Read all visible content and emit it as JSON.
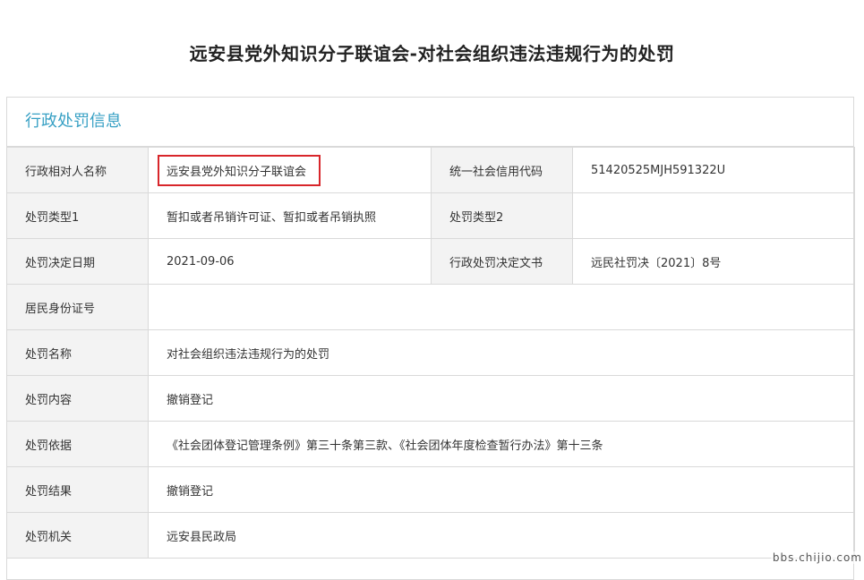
{
  "page": {
    "title": "远安县党外知识分子联谊会-对社会组织违法违规行为的处罚"
  },
  "section": {
    "title": "行政处罚信息"
  },
  "rows": {
    "subject_name": {
      "label": "行政相对人名称",
      "value": "远安县党外知识分子联谊会"
    },
    "credit_code": {
      "label": "统一社会信用代码",
      "value": "51420525MJH591322U"
    },
    "penalty_type1": {
      "label": "处罚类型1",
      "value": "暂扣或者吊销许可证、暂扣或者吊销执照"
    },
    "penalty_type2": {
      "label": "处罚类型2",
      "value": ""
    },
    "decision_date": {
      "label": "处罚决定日期",
      "value": "2021-09-06"
    },
    "decision_doc": {
      "label": "行政处罚决定文书",
      "value": "远民社罚决〔2021〕8号"
    },
    "id_number": {
      "label": "居民身份证号",
      "value": ""
    },
    "penalty_name": {
      "label": "处罚名称",
      "value": "对社会组织违法违规行为的处罚"
    },
    "penalty_content": {
      "label": "处罚内容",
      "value": "撤销登记"
    },
    "penalty_basis": {
      "label": "处罚依据",
      "value": "《社会团体登记管理条例》第三十条第三款、《社会团体年度检查暂行办法》第十三条"
    },
    "penalty_result": {
      "label": "处罚结果",
      "value": "撤销登记"
    },
    "penalty_authority": {
      "label": "处罚机关",
      "value": "远安县民政局"
    }
  },
  "watermark": "bbs.chijio.com",
  "colors": {
    "section_title": "#37a0c4",
    "highlight_border": "#d8262b",
    "label_bg": "#f3f3f3"
  }
}
